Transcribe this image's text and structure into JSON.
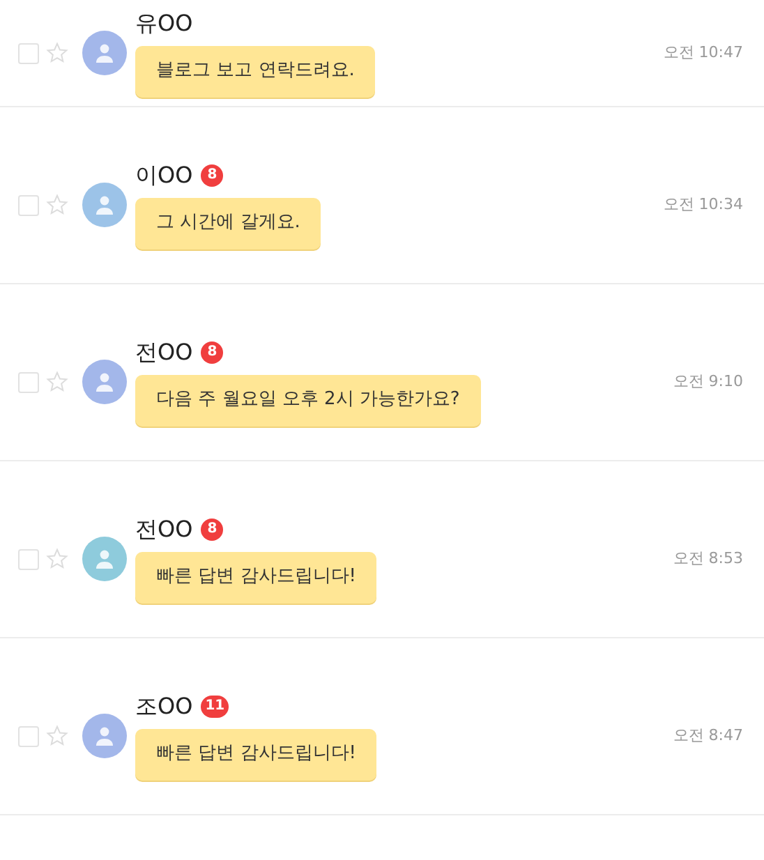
{
  "conversations": [
    {
      "name": "유OO",
      "message": "블로그 보고 연락드려요.",
      "time": "오전 10:47",
      "checked": false,
      "starred": false,
      "color": "#a3b7ea"
    },
    {
      "name": "이OO",
      "unread": "8",
      "message": "그 시간에 갈게요.",
      "time": "오전 10:34",
      "checked": false,
      "starred": false,
      "color": "#9cc3e8"
    },
    {
      "name": "전OO",
      "unread": "8",
      "message": "다음 주 월요일 오후 2시 가능한가요?",
      "time": "오전 9:10",
      "checked": false,
      "starred": false,
      "color": "#a3b7ea"
    },
    {
      "name": "전OO",
      "unread": "8",
      "message": "빠른 답변 감사드립니다!",
      "time": "오전 8:53",
      "checked": false,
      "starred": false,
      "color": "#8ecbdc"
    },
    {
      "name": "조OO",
      "unread": "11",
      "message": "빠른 답변 감사드립니다!",
      "time": "오전 8:47",
      "checked": false,
      "starred": false,
      "color": "#a3b7ea"
    }
  ]
}
